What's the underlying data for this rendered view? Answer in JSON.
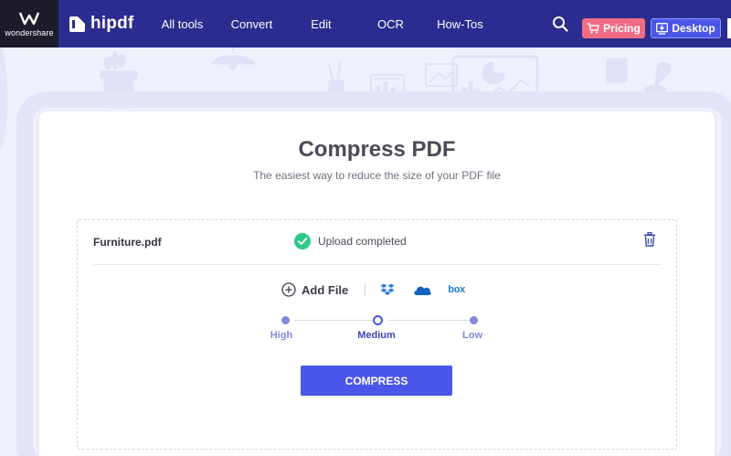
{
  "brand": {
    "company": "wondershare",
    "product": "hipdf"
  },
  "nav": {
    "items": [
      "All tools",
      "Convert",
      "Edit",
      "OCR",
      "How-Tos"
    ],
    "pricing_label": "Pricing",
    "desktop_label": "Desktop"
  },
  "page": {
    "title": "Compress PDF",
    "subtitle": "The easiest way to reduce the size of your PDF file"
  },
  "upload": {
    "file_name": "Furniture.pdf",
    "status": "Upload completed",
    "add_file_label": "Add File",
    "cloud_sources": [
      "dropbox",
      "onedrive",
      "box"
    ],
    "box_label": "box"
  },
  "compression": {
    "levels": [
      "High",
      "Medium",
      "Low"
    ],
    "selected": "Medium",
    "button_label": "COMPRESS"
  },
  "colors": {
    "topbar": "#2b2c8f",
    "accent": "#4a56e8",
    "pricing": "#f06c85",
    "success": "#2ec88a",
    "background": "#eef0fb"
  }
}
